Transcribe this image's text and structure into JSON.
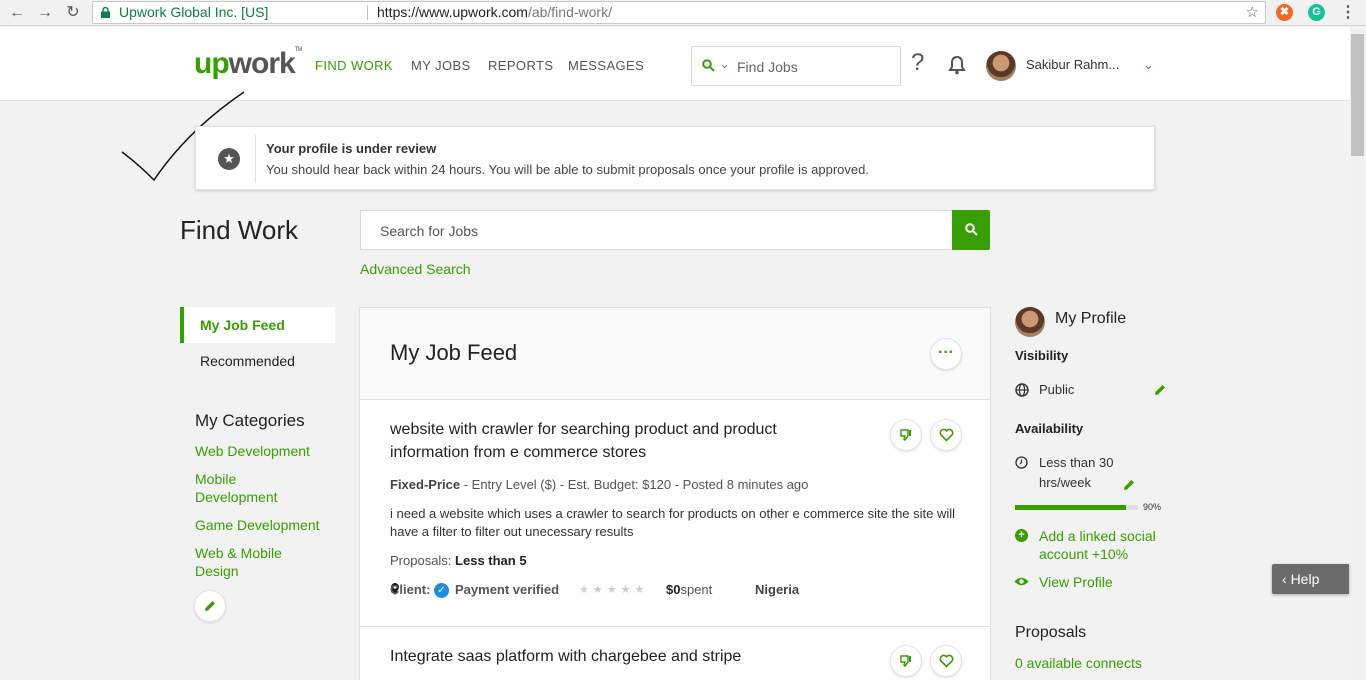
{
  "browser": {
    "site_identity": "Upwork Global Inc. [US]",
    "url_host": "https://www.upwork.com",
    "url_path": "/ab/find-work/"
  },
  "header": {
    "logo_up": "up",
    "logo_work": "work",
    "logo_tm": "TM",
    "nav": [
      "FIND WORK",
      "MY JOBS",
      "REPORTS",
      "MESSAGES"
    ],
    "search_placeholder": "Find Jobs",
    "help": "?",
    "user_name": "Sakibur Rahm..."
  },
  "notice": {
    "title": "Your profile is under review",
    "message": "You should hear back within 24 hours. You will be able to submit proposals once your profile is approved."
  },
  "find_work": {
    "title": "Find Work",
    "search_placeholder": "Search for Jobs",
    "advanced_search": "Advanced Search"
  },
  "sidebar": {
    "tabs": [
      "My Job Feed",
      "Recommended"
    ],
    "categories_title": "My Categories",
    "categories": [
      "Web Development",
      "Mobile Development",
      "Game Development",
      "Web & Mobile Design"
    ]
  },
  "feed": {
    "title": "My Job Feed",
    "jobs": [
      {
        "title": "website with crawler for searching product and product information from e commerce stores",
        "type": "Fixed-Price",
        "meta_rest": "- Entry Level ($) - Est. Budget: $120 - Posted 8 minutes ago",
        "description": "i need a website which uses a crawler to search for products on other e commerce site the site will have a filter to filter out unecessary results",
        "proposals_label": "Proposals:",
        "proposals_value": "Less than 5",
        "client_label": "Client:",
        "payment": "Payment verified",
        "spent_amount": "$0",
        "spent_label": "spent",
        "location": "Nigeria"
      },
      {
        "title": "Integrate saas platform with chargebee and stripe"
      }
    ]
  },
  "profile": {
    "title": "My Profile",
    "visibility_label": "Visibility",
    "visibility_value": "Public",
    "availability_label": "Availability",
    "availability_value": "Less than 30 hrs/week",
    "completeness_pct": 90,
    "completeness_text": "90%",
    "add_social": "Add a linked social account +10%",
    "view_profile": "View Profile",
    "proposals_title": "Proposals",
    "connects": "0 available connects"
  },
  "help_tab": "Help",
  "colors": {
    "brand_green": "#37a000",
    "verified_blue": "#1d8fe1"
  }
}
